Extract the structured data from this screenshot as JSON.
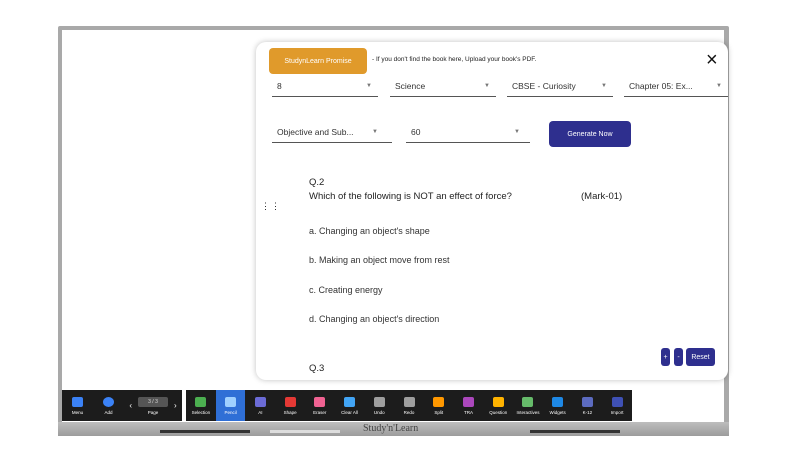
{
  "modal": {
    "promise_label": "StudynLearn Promise",
    "note": "- If you don't find the book here, Upload your book's PDF.",
    "close_icon": "×",
    "selects": {
      "grade": "8",
      "subject": "Science",
      "book": "CBSE - Curiosity",
      "chapter": "Chapter 05: Ex...",
      "type": "Objective and Sub...",
      "count": "60"
    },
    "generate_label": "Generate Now",
    "question": {
      "number": "Q.2",
      "text": "Which of the following is NOT an effect of force?",
      "mark": "(Mark-01)",
      "options": [
        "a. Changing an object's shape",
        "b. Making an object move from rest",
        "c. Creating energy",
        "d. Changing an object's direction"
      ]
    },
    "next_question": "Q.3",
    "zoom_in": "+",
    "zoom_out": "-",
    "reset_label": "Reset"
  },
  "toolbar": {
    "left": [
      {
        "label": "Menu",
        "icon": "grid-icon",
        "color": "#3b82f6"
      },
      {
        "label": "Add",
        "icon": "plus-circle-icon",
        "color": "#3b82f6"
      }
    ],
    "page": {
      "label": "Page",
      "value": "3 / 3"
    },
    "tools": [
      {
        "label": "Selection",
        "icon": "selection-icon",
        "color": "#4caf50"
      },
      {
        "label": "Pencil",
        "icon": "pencil-icon",
        "color": "#9fd0ff",
        "active": true
      },
      {
        "label": "AI",
        "icon": "ai-icon",
        "color": "#6b6bd6"
      },
      {
        "label": "Shape",
        "icon": "shape-icon",
        "color": "#e53935"
      },
      {
        "label": "Eraser",
        "icon": "eraser-icon",
        "color": "#f06292"
      },
      {
        "label": "Clear All",
        "icon": "broom-icon",
        "color": "#42a5f5"
      },
      {
        "label": "Undo",
        "icon": "undo-icon",
        "color": "#9e9e9e"
      },
      {
        "label": "Redo",
        "icon": "redo-icon",
        "color": "#9e9e9e"
      },
      {
        "label": "Split",
        "icon": "split-icon",
        "color": "#ff9800"
      },
      {
        "label": "TRA",
        "icon": "tra-icon",
        "color": "#ab47bc"
      },
      {
        "label": "Question",
        "icon": "question-icon",
        "color": "#ffb300"
      },
      {
        "label": "Interactives",
        "icon": "interactives-icon",
        "color": "#66bb6a"
      },
      {
        "label": "Widgets",
        "icon": "widgets-icon",
        "color": "#1e88e5"
      },
      {
        "label": "K-12",
        "icon": "k12-icon",
        "color": "#5c6bc0"
      },
      {
        "label": "Import",
        "icon": "import-icon",
        "color": "#3f51b5"
      }
    ]
  },
  "bezel": {
    "brand": "Study'n'Learn"
  }
}
